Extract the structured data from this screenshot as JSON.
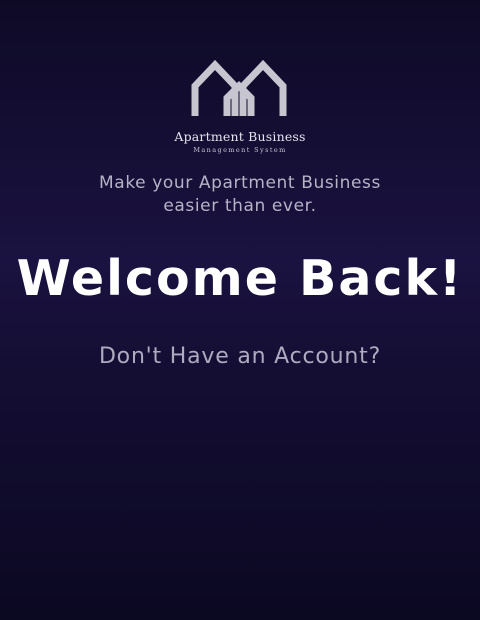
{
  "brand": {
    "logo_icon": "houses-logo-icon",
    "name": "Apartment Business",
    "subtitle": "Management System"
  },
  "tagline": {
    "line1": "Make your Apartment Business",
    "line2": "easier than ever."
  },
  "heading": "Welcome Back!",
  "signup_link": "Don't Have an Account?",
  "colors": {
    "background_top": "#0e0a26",
    "background_mid": "#1a1240",
    "background_bottom": "#0b0822",
    "logo": "#c7c5d0",
    "heading": "#ffffff",
    "muted_text": "#b7b3c7"
  }
}
